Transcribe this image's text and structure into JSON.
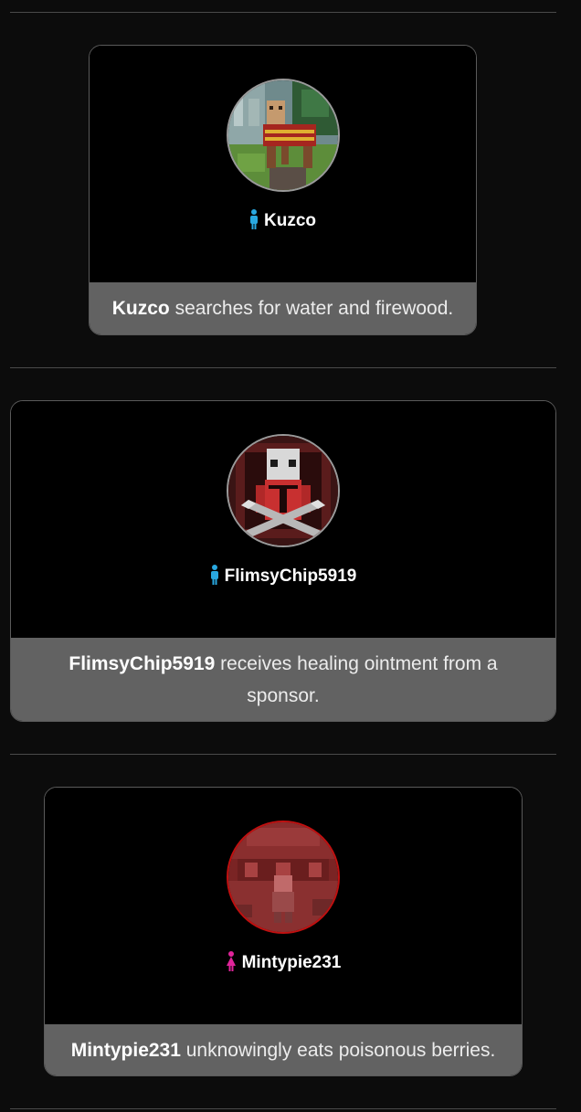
{
  "events": [
    {
      "tribute_name": "Kuzco",
      "gender": "male",
      "gender_icon": "male-person-icon",
      "status": "alive",
      "action_text": " searches for water and firewood."
    },
    {
      "tribute_name": "FlimsyChip5919",
      "gender": "male",
      "gender_icon": "male-person-icon",
      "status": "alive",
      "action_text": " receives healing ointment from a sponsor."
    },
    {
      "tribute_name": "Mintypie231",
      "gender": "female",
      "gender_icon": "female-person-icon",
      "status": "dead",
      "action_text": " unknowingly eats poisonous berries."
    }
  ],
  "colors": {
    "background": "#0c0c0c",
    "card": "#000000",
    "caption": "#626262",
    "male": "#29a8e0",
    "female": "#e0249a",
    "dead_border": "#c01010"
  }
}
